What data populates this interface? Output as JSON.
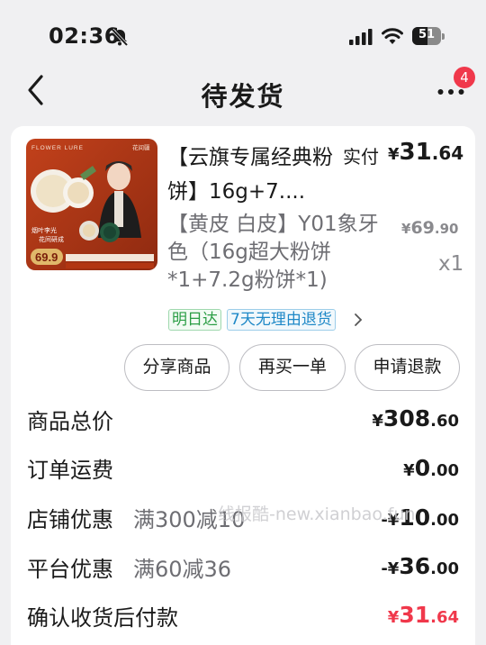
{
  "status_bar": {
    "time": "02:36",
    "battery": "51"
  },
  "nav": {
    "title": "待发货",
    "badge_count": "4"
  },
  "product": {
    "image": {
      "brand": "FLOWER LURE",
      "brand_cn": "花间疆",
      "slogan_1": "烟叶李光",
      "slogan_2": "花间研成",
      "price_badge": "69.9"
    },
    "title": "【云旗专属经典粉饼】16g+7....",
    "paid_label": "实付",
    "paid_price": {
      "symbol": "¥",
      "integer": "31",
      "decimal": ".64"
    },
    "spec": "【黄皮 白皮】Y01象牙色（16g超大粉饼*1+7.2g粉饼*1)",
    "original_price": {
      "symbol": "¥",
      "integer": "69",
      "decimal": ".90"
    },
    "quantity": "x1",
    "tags": [
      "明日达",
      "7天无理由退货"
    ]
  },
  "actions": {
    "share": "分享商品",
    "rebuy": "再买一单",
    "refund": "申请退款"
  },
  "summary": {
    "subtotal": {
      "label": "商品总价",
      "symbol": "¥",
      "integer": "308",
      "decimal": ".60"
    },
    "shipping": {
      "label": "订单运费",
      "symbol": "¥",
      "integer": "0",
      "decimal": ".00"
    },
    "shop_discount": {
      "label": "店铺优惠",
      "sub": "满300减10",
      "symbol": "-¥",
      "integer": "10",
      "decimal": ".00"
    },
    "platform_discount": {
      "label": "平台优惠",
      "sub": "满60减36",
      "symbol": "-¥",
      "integer": "36",
      "decimal": ".00"
    },
    "final": {
      "label": "确认收货后付款",
      "symbol": "¥",
      "integer": "31",
      "decimal": ".64"
    }
  },
  "watermark": "线报酷-new.xianbao.fun",
  "colors": {
    "accent_red": "#f0384b",
    "tag_green": "#2a9d44",
    "tag_blue": "#1e88c7"
  }
}
